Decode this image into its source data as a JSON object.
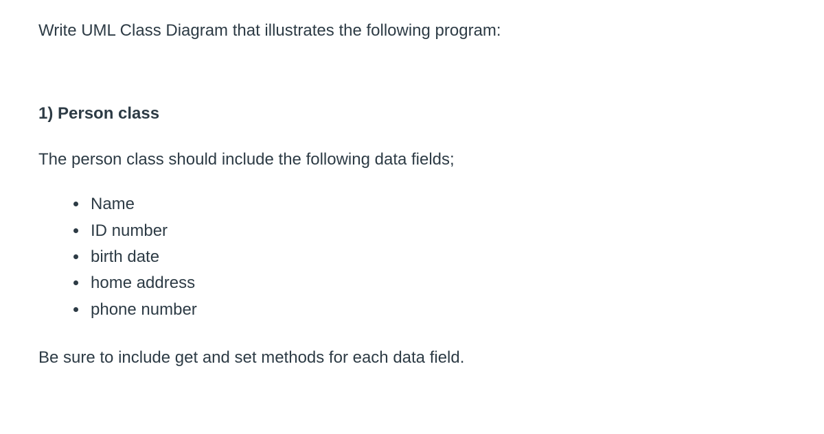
{
  "intro": "Write  UML Class Diagram that illustrates the following program:",
  "section": {
    "heading": "1) Person class",
    "description": "The person class should include the following data fields;",
    "fields": [
      "Name",
      "ID number",
      "birth date",
      "home address",
      "phone number"
    ],
    "note": "Be sure to include get and set methods for each data field."
  }
}
